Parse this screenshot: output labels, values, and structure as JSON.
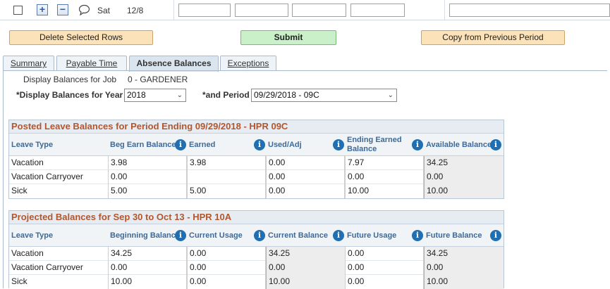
{
  "top_row": {
    "day": "Sat",
    "date": "12/8"
  },
  "buttons": {
    "delete": "Delete Selected Rows",
    "submit": "Submit",
    "copy": "Copy from Previous Period"
  },
  "tabs": [
    {
      "label": "Summary"
    },
    {
      "label": "Payable Time"
    },
    {
      "label": "Absence Balances"
    },
    {
      "label": "Exceptions"
    }
  ],
  "filters": {
    "job_label": "Display Balances for Job",
    "job_value": "0 - GARDENER",
    "year_label": "*Display Balances for Year",
    "year_value": "2018",
    "period_label": "*and Period",
    "period_value": "09/29/2018 - 09C"
  },
  "posted": {
    "title": "Posted Leave Balances for Period Ending 09/29/2018 - HPR 09C",
    "headers": [
      "Leave Type",
      "Beg Earn Balance",
      "Earned",
      "Used/Adj",
      "Ending Earned Balance",
      "Available Balance"
    ],
    "rows": [
      [
        "Vacation",
        "3.98",
        "3.98",
        "0.00",
        "7.97",
        "34.25"
      ],
      [
        "Vacation Carryover",
        "0.00",
        "",
        "0.00",
        "0.00",
        "0.00"
      ],
      [
        "Sick",
        "5.00",
        "5.00",
        "0.00",
        "10.00",
        "10.00"
      ]
    ]
  },
  "projected": {
    "title": "Projected Balances for Sep 30 to Oct 13 - HPR 10A",
    "headers": [
      "Leave Type",
      "Beginning Balance",
      "Current Usage",
      "Current Balance",
      "Future Usage",
      "Future Balance"
    ],
    "rows": [
      [
        "Vacation",
        "34.25",
        "0.00",
        "34.25",
        "0.00",
        "34.25"
      ],
      [
        "Vacation Carryover",
        "0.00",
        "0.00",
        "0.00",
        "0.00",
        "0.00"
      ],
      [
        "Sick",
        "10.00",
        "0.00",
        "10.00",
        "0.00",
        "10.00"
      ]
    ]
  },
  "icons": {
    "info": "i",
    "plus": "+",
    "minus": "−",
    "chevron": "⌄"
  }
}
